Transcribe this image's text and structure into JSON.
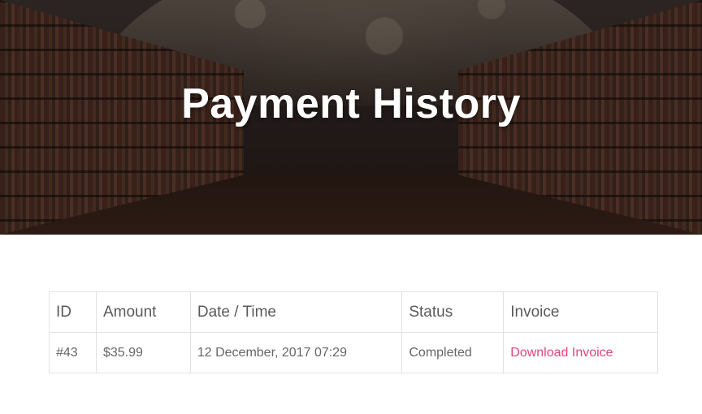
{
  "hero": {
    "title": "Payment History"
  },
  "table": {
    "headers": {
      "id": "ID",
      "amount": "Amount",
      "datetime": "Date / Time",
      "status": "Status",
      "invoice": "Invoice"
    },
    "rows": [
      {
        "id": "#43",
        "amount": "$35.99",
        "datetime": "12 December, 2017 07:29",
        "status": "Completed",
        "invoice": "Download Invoice"
      }
    ]
  },
  "colors": {
    "link": "#e0457b",
    "border": "#e2e2e2",
    "hero_text": "#ffffff"
  }
}
